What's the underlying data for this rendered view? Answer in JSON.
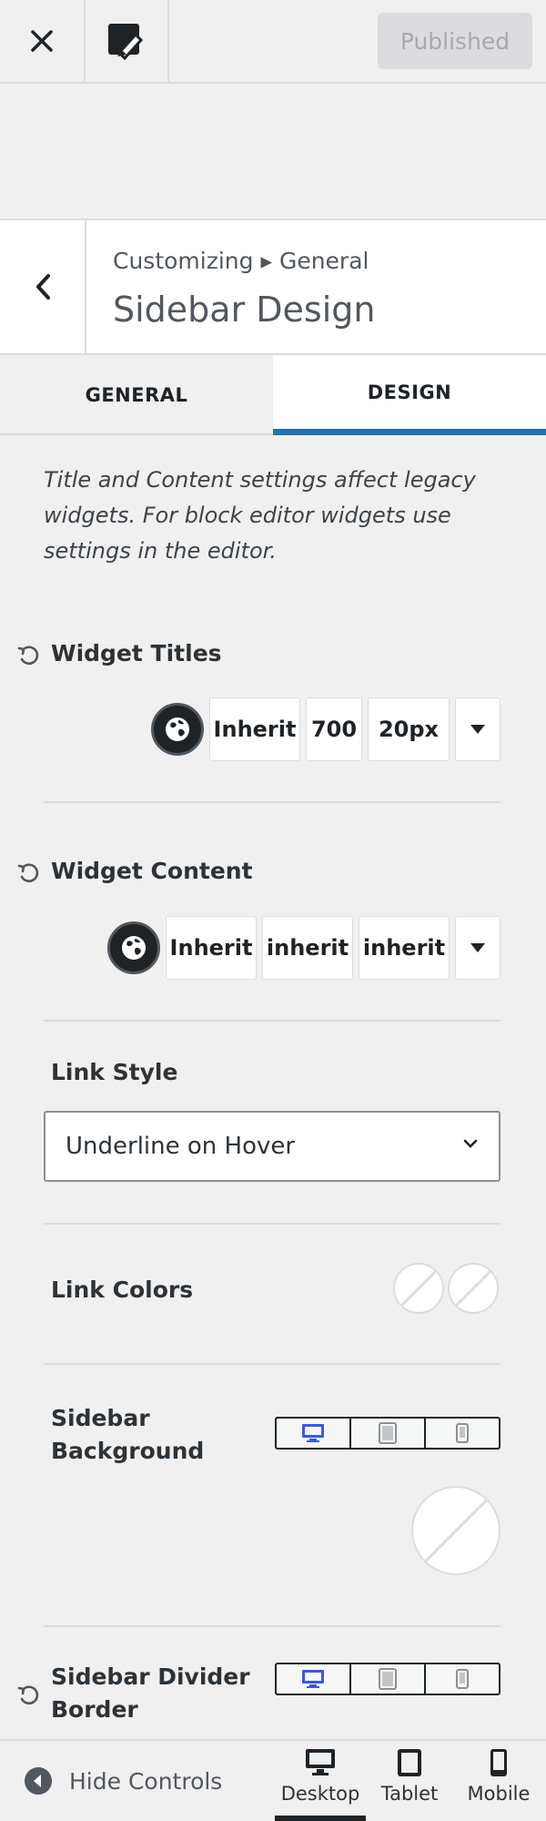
{
  "topbar": {
    "close_icon": "close-icon",
    "theme_icon": "brush-icon",
    "publish_label": "Published"
  },
  "section": {
    "breadcrumb": "Customizing ▸ General",
    "title": "Sidebar Design"
  },
  "tabs": [
    {
      "label": "GENERAL",
      "active": false
    },
    {
      "label": "DESIGN",
      "active": true
    }
  ],
  "notice": "Title and Content settings affect legacy widgets. For block editor widgets use settings in the editor.",
  "widget_titles": {
    "label": "Widget Titles",
    "font_family": "Inherit",
    "font_weight": "700",
    "font_size": "20px"
  },
  "widget_content": {
    "label": "Widget Content",
    "font_family": "Inherit",
    "font_weight": "inherit",
    "font_size": "inherit"
  },
  "link_style": {
    "label": "Link Style",
    "value": "Underline on Hover"
  },
  "link_colors": {
    "label": "Link Colors"
  },
  "sidebar_background": {
    "label_line1": "Sidebar",
    "label_line2": "Background"
  },
  "sidebar_divider": {
    "label_line1": "Sidebar Divider",
    "label_line2": "Border"
  },
  "footer": {
    "hide_controls": "Hide Controls",
    "devices": [
      {
        "label": "Desktop",
        "active": true
      },
      {
        "label": "Tablet",
        "active": false
      },
      {
        "label": "Mobile",
        "active": false
      }
    ]
  },
  "colors": {
    "accent": "#2271b1",
    "active_device": "#3858e9",
    "border": "#dcdcde"
  }
}
